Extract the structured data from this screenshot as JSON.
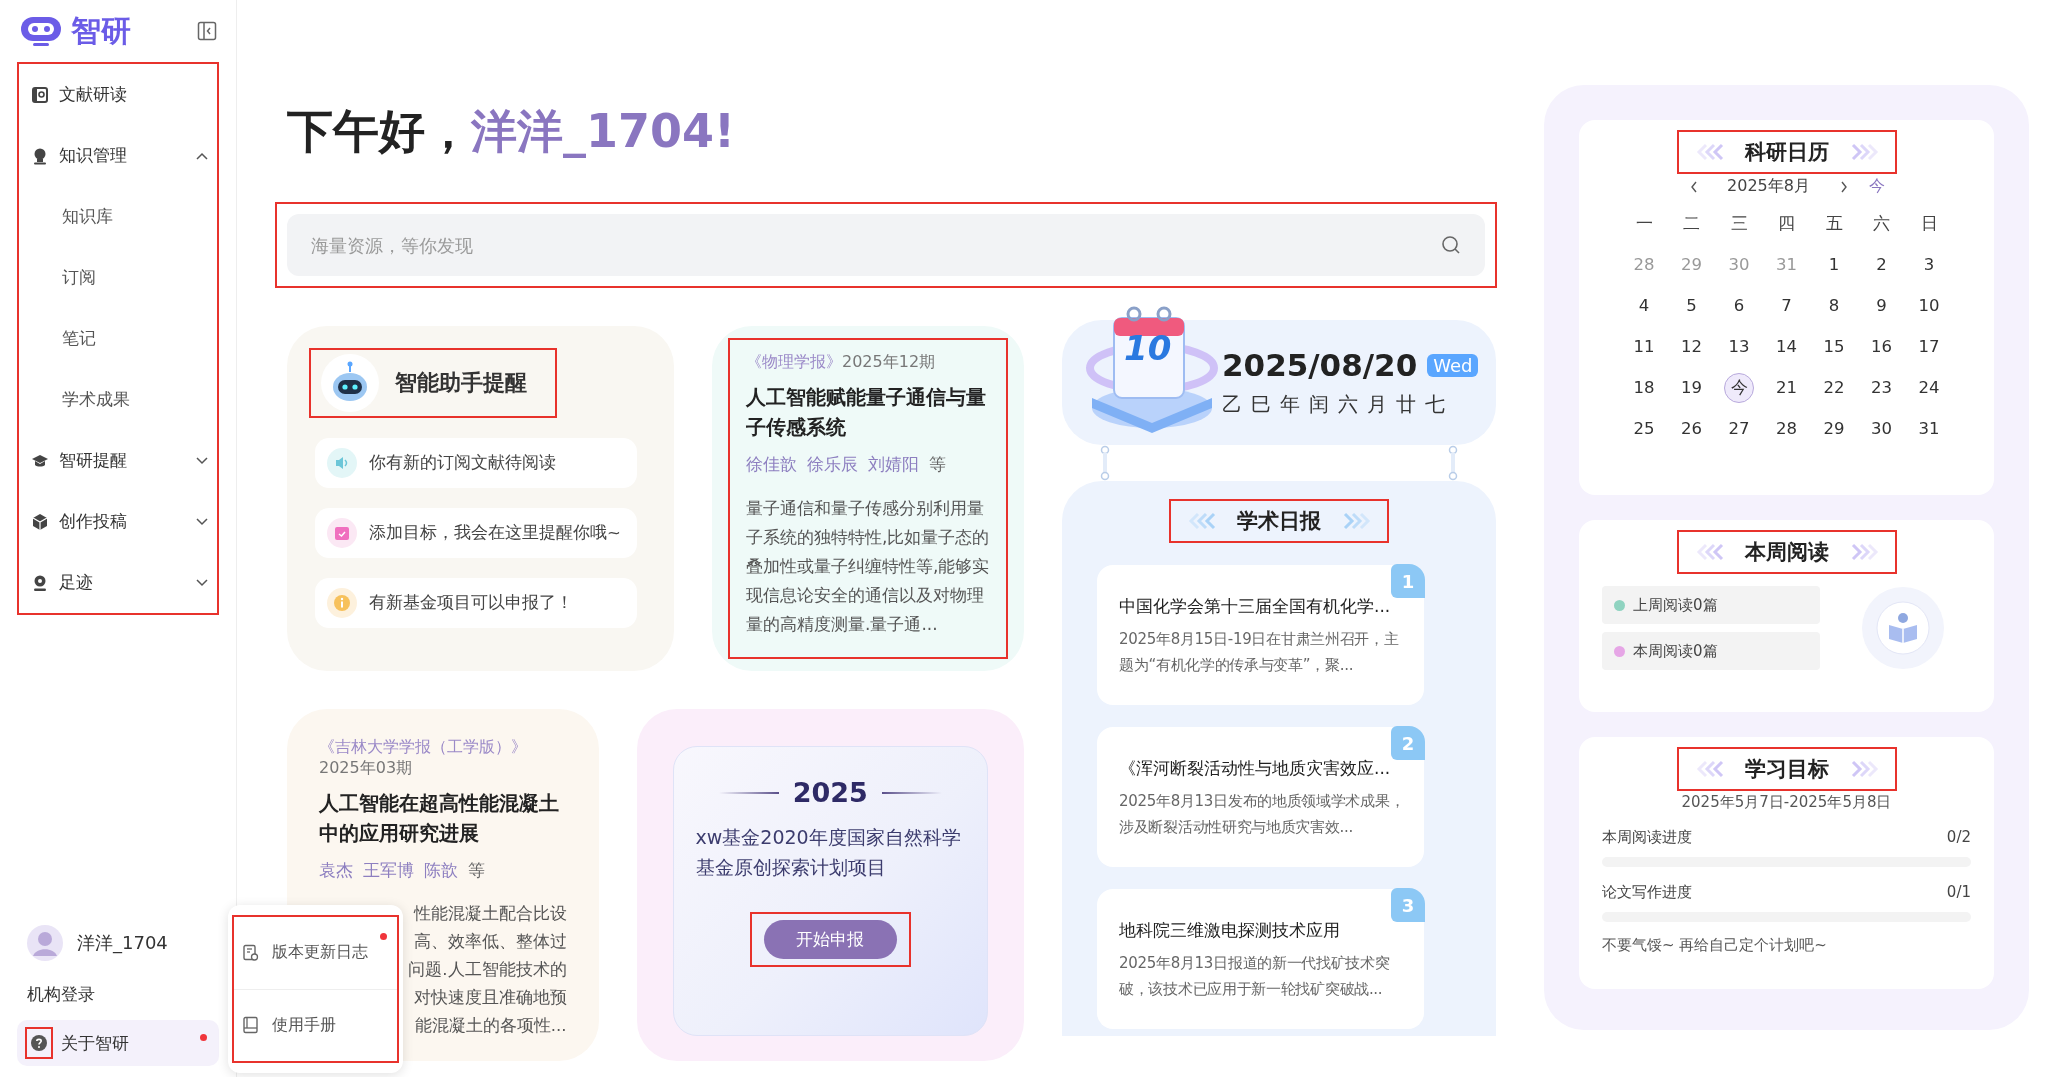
{
  "sidebar": {
    "logo_text": "智研",
    "highlighted": true,
    "nav": [
      {
        "label": "文献研读",
        "kind": "link"
      },
      {
        "label": "知识管理",
        "kind": "group",
        "expanded": true,
        "children": [
          {
            "label": "知识库"
          },
          {
            "label": "订阅"
          },
          {
            "label": "笔记"
          },
          {
            "label": "学术成果"
          }
        ]
      },
      {
        "label": "智研提醒",
        "kind": "group",
        "expanded": false
      },
      {
        "label": "创作投稿",
        "kind": "group",
        "expanded": false
      },
      {
        "label": "足迹",
        "kind": "group",
        "expanded": false
      }
    ],
    "user": {
      "name": "洋洋_1704"
    },
    "org_login": "机构登录",
    "about": {
      "label": "关于智研",
      "dot": true,
      "icon_highlighted": true
    }
  },
  "popup_menu": {
    "highlighted": true,
    "items": [
      {
        "label": "版本更新日志",
        "dot": true
      },
      {
        "label": "使用手册",
        "dot": false
      }
    ]
  },
  "greeting": {
    "prefix": "下午好，",
    "name": "洋洋_1704",
    "suffix": "!"
  },
  "search": {
    "placeholder": "海量资源，等你发现",
    "highlighted": true
  },
  "assistant": {
    "title": "智能助手提醒",
    "title_highlighted": true,
    "items": [
      {
        "text": "你有新的订阅文献待阅读"
      },
      {
        "text": "添加目标，我会在这里提醒你哦~"
      },
      {
        "text": "有新基金项目可以申报了！"
      }
    ]
  },
  "paper_1": {
    "highlighted": true,
    "journal": "《物理学报》",
    "issue": "2025年12期",
    "title": "人工智能赋能量子通信与量子传感系统",
    "authors": [
      "徐佳歆",
      "徐乐辰",
      "刘婧阳"
    ],
    "authors_suffix": "等",
    "abstract": "量子通信和量子传感分别利用量子系统的独特特性,比如量子态的叠加性或量子纠缠特性等,能够实现信息论安全的通信以及对物理量的高精度测量.量子通..."
  },
  "paper_2": {
    "journal": "《吉林大学学报（工学版）》",
    "issue": "2025年03期",
    "title": "人工智能在超高性能混凝土中的应用研究进展",
    "authors": [
      "袁杰",
      "王军博",
      "陈歆"
    ],
    "authors_suffix": "等",
    "abstract_lines": [
      "性能混凝土配合比设",
      "高、效率低、整体过",
      "问题.人工智能技术的",
      "对快速度且准确地预",
      "能混凝土的各项性..."
    ]
  },
  "fund": {
    "year": "2025",
    "title": "xw基金2020年度国家自然科学基金原创探索计划项目",
    "button": "开始申报",
    "button_highlighted": true
  },
  "today": {
    "illustration_text": "10",
    "date": "2025/08/20",
    "weekday": "Wed",
    "lunar": "乙巳年闰六月廿七"
  },
  "daily": {
    "title": "学术日报",
    "title_highlighted": true,
    "items": [
      {
        "rank": "1",
        "title": "中国化学会第十三届全国有机化学...",
        "summary": "2025年8月15日-19日在甘肃兰州召开，主题为“有机化学的传承与变革”，聚..."
      },
      {
        "rank": "2",
        "title": "《浑河断裂活动性与地质灾害效应...",
        "summary": "2025年8月13日发布的地质领域学术成果，涉及断裂活动性研究与地质灾害效..."
      },
      {
        "rank": "3",
        "title": "地科院三维激电探测技术应用",
        "summary": "2025年8月13日报道的新一代找矿技术突破，该技术已应用于新一轮找矿突破战..."
      }
    ]
  },
  "calendar": {
    "title": "科研日历",
    "title_highlighted": true,
    "month": "2025年8月",
    "today_button": "今",
    "weekdays": [
      "一",
      "二",
      "三",
      "四",
      "五",
      "六",
      "日"
    ],
    "weeks": [
      [
        {
          "d": "28",
          "other": true,
          "today": false
        },
        {
          "d": "29",
          "other": true,
          "today": false
        },
        {
          "d": "30",
          "other": true,
          "today": false
        },
        {
          "d": "31",
          "other": true,
          "today": false
        },
        {
          "d": "1",
          "other": false,
          "today": false
        },
        {
          "d": "2",
          "other": false,
          "today": false
        },
        {
          "d": "3",
          "other": false,
          "today": false
        }
      ],
      [
        {
          "d": "4",
          "other": false,
          "today": false
        },
        {
          "d": "5",
          "other": false,
          "today": false
        },
        {
          "d": "6",
          "other": false,
          "today": false
        },
        {
          "d": "7",
          "other": false,
          "today": false
        },
        {
          "d": "8",
          "other": false,
          "today": false
        },
        {
          "d": "9",
          "other": false,
          "today": false
        },
        {
          "d": "10",
          "other": false,
          "today": false
        }
      ],
      [
        {
          "d": "11",
          "other": false,
          "today": false
        },
        {
          "d": "12",
          "other": false,
          "today": false
        },
        {
          "d": "13",
          "other": false,
          "today": false
        },
        {
          "d": "14",
          "other": false,
          "today": false
        },
        {
          "d": "15",
          "other": false,
          "today": false
        },
        {
          "d": "16",
          "other": false,
          "today": false
        },
        {
          "d": "17",
          "other": false,
          "today": false
        }
      ],
      [
        {
          "d": "18",
          "other": false,
          "today": false
        },
        {
          "d": "19",
          "other": false,
          "today": false
        },
        {
          "d": "今",
          "other": false,
          "today": true
        },
        {
          "d": "21",
          "other": false,
          "today": false
        },
        {
          "d": "22",
          "other": false,
          "today": false
        },
        {
          "d": "23",
          "other": false,
          "today": false
        },
        {
          "d": "24",
          "other": false,
          "today": false
        }
      ],
      [
        {
          "d": "25",
          "other": false,
          "today": false
        },
        {
          "d": "26",
          "other": false,
          "today": false
        },
        {
          "d": "27",
          "other": false,
          "today": false
        },
        {
          "d": "28",
          "other": false,
          "today": false
        },
        {
          "d": "29",
          "other": false,
          "today": false
        },
        {
          "d": "30",
          "other": false,
          "today": false
        },
        {
          "d": "31",
          "other": false,
          "today": false
        }
      ]
    ]
  },
  "reading": {
    "title": "本周阅读",
    "title_highlighted": true,
    "legend": [
      {
        "label": "上周阅读0篇",
        "color": "#8fd3c0"
      },
      {
        "label": "本周阅读0篇",
        "color": "#e6a6e6"
      }
    ]
  },
  "goals": {
    "title": "学习目标",
    "title_highlighted": true,
    "range": "2025年5月7日-2025年5月8日",
    "items": [
      {
        "label": "本周阅读进度",
        "count": "0/2",
        "level": 0
      },
      {
        "label": "论文写作进度",
        "count": "0/1",
        "level": 0
      }
    ],
    "note": "不要气馁~ 再给自己定个计划吧~"
  }
}
